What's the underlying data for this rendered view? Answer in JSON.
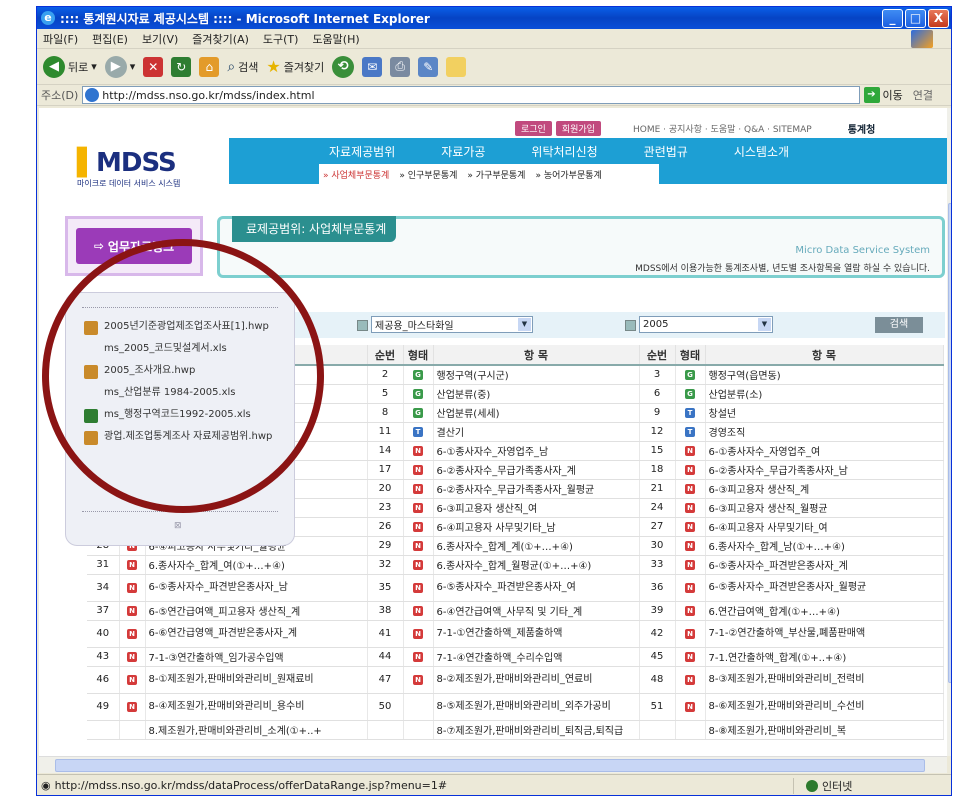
{
  "window": {
    "title": ":::: 통계원시자료 제공시스템 :::: - Microsoft Internet Explorer",
    "min": "_",
    "max": "□",
    "close": "X"
  },
  "menu": {
    "items": [
      "파일(F)",
      "편집(E)",
      "보기(V)",
      "즐겨찾기(A)",
      "도구(T)",
      "도움말(H)"
    ]
  },
  "toolbar": {
    "back": "뒤로",
    "search": "검색",
    "favorites": "즐겨찾기"
  },
  "address": {
    "label": "주소(D)",
    "url": "http://mdss.nso.go.kr/mdss/index.html",
    "go": "이동",
    "links": "연결"
  },
  "site": {
    "top_buttons": [
      "로그인",
      "회원가입"
    ],
    "top_links": "HOME · 공지사항 · 도움말 · Q&A · SITEMAP",
    "agency": "통계청",
    "logo_main": "MDSS",
    "logo_sub": "마이크로 데이터 서비스 시스템",
    "nav": [
      "자료제공범위",
      "자료가공",
      "위탁처리신청",
      "관련법규",
      "시스템소개"
    ],
    "subnav": [
      "» 사업체부문통계",
      "» 인구부문통계",
      "» 가구부문통계",
      "» 농어가부문통계"
    ],
    "side_button": "업무자료링크",
    "banner_tab": "료제공범위: 사업체부문통계",
    "banner_brand": "Micro Data Service System",
    "banner_desc": "MDSS에서 이용가능한 통계조사별, 년도별 조사항목을 열람 하실 수 있습니다."
  },
  "popup": {
    "files": [
      {
        "name": "2005년기준광업제조업조사표[1].hwp",
        "icon": "hwp-icon"
      },
      {
        "name": "ms_2005_코드및설계서.xls",
        "icon": ""
      },
      {
        "name": "2005_조사개요.hwp",
        "icon": "hwp-icon"
      },
      {
        "name": "ms_산업분류 1984-2005.xls",
        "icon": ""
      },
      {
        "name": "ms_행정구역코드1992-2005.xls",
        "icon": "excel-icon"
      },
      {
        "name": "광업.제조업통계조사 자료제공범위.hwp",
        "icon": "hwp-icon"
      }
    ],
    "close": "⊠"
  },
  "filter": {
    "file": "제공용_마스타화일",
    "year": "2005",
    "search": "검색"
  },
  "table": {
    "headers": [
      "",
      "",
      "",
      "순번",
      "형태",
      "항 목",
      "순번",
      "형태",
      "항 목"
    ],
    "rows": [
      {
        "l": [
          "",
          "",
          ""
        ],
        "m": [
          "2",
          "G",
          "행정구역(구시군)"
        ],
        "r": [
          "3",
          "G",
          "행정구역(읍면동)"
        ]
      },
      {
        "l": [
          "",
          "",
          ""
        ],
        "m": [
          "5",
          "G",
          "산업분류(중)"
        ],
        "r": [
          "6",
          "G",
          "산업분류(소)"
        ]
      },
      {
        "l": [
          "",
          "",
          ""
        ],
        "m": [
          "8",
          "G",
          "산업분류(세세)"
        ],
        "r": [
          "9",
          "T",
          "창설년"
        ]
      },
      {
        "l": [
          "",
          "",
          ""
        ],
        "m": [
          "11",
          "T",
          "결산기"
        ],
        "r": [
          "12",
          "T",
          "경영조직"
        ]
      },
      {
        "l": [
          "",
          "",
          ""
        ],
        "m": [
          "14",
          "N",
          "6-①종사자수_자영업주_남"
        ],
        "r": [
          "15",
          "N",
          "6-①종사자수_자영업주_여"
        ]
      },
      {
        "l": [
          "",
          "",
          "월평균"
        ],
        "m": [
          "17",
          "N",
          "6-②종사자수_무급가족종사자_계"
        ],
        "r": [
          "18",
          "N",
          "6-②종사자수_무급가족종사자_남"
        ]
      },
      {
        "l": [
          "",
          "",
          "사자_여"
        ],
        "m": [
          "20",
          "N",
          "6-②종사자수_무급가족종사자_월평균"
        ],
        "r": [
          "21",
          "N",
          "6-③피고용자 생산직_계"
        ]
      },
      {
        "l": [
          "",
          "",
          ""
        ],
        "m": [
          "23",
          "N",
          "6-③피고용자 생산직_여"
        ],
        "r": [
          "24",
          "N",
          "6-③피고용자 생산직_월평균"
        ]
      },
      {
        "l": [
          "",
          "",
          "_계"
        ],
        "m": [
          "26",
          "N",
          "6-④피고용자 사무및기타_남"
        ],
        "r": [
          "27",
          "N",
          "6-④피고용자 사무및기타_여"
        ]
      },
      {
        "l": [
          "28",
          "N",
          "6-④피고용자 사무및기타_월평균"
        ],
        "m": [
          "29",
          "N",
          "6.종사자수_합계_계(①+…+④)"
        ],
        "r": [
          "30",
          "N",
          "6.종사자수_합계_남(①+…+④)"
        ]
      },
      {
        "l": [
          "31",
          "N",
          "6.종사자수_합계_여(①+…+④)"
        ],
        "m": [
          "32",
          "N",
          "6.종사자수_합계_월평균(①+…+④)"
        ],
        "r": [
          "33",
          "N",
          "6-⑤종사자수_파견받은종사자_계"
        ]
      },
      {
        "l": [
          "34",
          "N",
          "6-⑤종사자수_파견받은종사자_남"
        ],
        "m": [
          "35",
          "N",
          "6-⑤종사자수_파견받은종사자_여"
        ],
        "r": [
          "36",
          "N",
          "6-⑤종사자수_파견받은종사자_월평균"
        ],
        "tall": true
      },
      {
        "l": [
          "37",
          "N",
          "6-⑤연간급여액_피고용자 생산직_계"
        ],
        "m": [
          "38",
          "N",
          "6-④연간급여액_사무직 및 기타_계"
        ],
        "r": [
          "39",
          "N",
          "6.연간급여액_합계(①+…+④)"
        ]
      },
      {
        "l": [
          "40",
          "N",
          "6-⑥연간급영액_파견받은종사자_계"
        ],
        "m": [
          "41",
          "N",
          "7-1-①연간출하액_제품출하액"
        ],
        "r": [
          "42",
          "N",
          "7-1-②연간출하액_부산물,폐품판매액"
        ],
        "tall": true
      },
      {
        "l": [
          "43",
          "N",
          "7-1-③연간출하액_임가공수입액"
        ],
        "m": [
          "44",
          "N",
          "7-1-④연간출하액_수리수입액"
        ],
        "r": [
          "45",
          "N",
          "7-1.연간출하액_합계(①+..+④)"
        ]
      },
      {
        "l": [
          "46",
          "N",
          "8-①제조원가,판매비와관리비_원재료비"
        ],
        "m": [
          "47",
          "N",
          "8-②제조원가,판매비와관리비_연료비"
        ],
        "r": [
          "48",
          "N",
          "8-③제조원가,판매비와관리비_전력비"
        ],
        "tall": true
      },
      {
        "l": [
          "49",
          "N",
          "8-④제조원가,판매비와관리비_용수비"
        ],
        "m": [
          "50",
          "",
          "8-⑤제조원가,판매비와관리비_외주가공비"
        ],
        "r": [
          "51",
          "N",
          "8-⑥제조원가,판매비와관리비_수선비"
        ],
        "tall": true
      },
      {
        "l": [
          "",
          "",
          "8.제조원가,판매비와관리비_소계(①+..+"
        ],
        "m": [
          "",
          "",
          "8-⑦제조원가,판매비와관리비_퇴직금,퇴직급"
        ],
        "r": [
          "",
          "",
          "8-⑧제조원가,판매비와관리비_복"
        ]
      }
    ]
  },
  "status": {
    "url": "http://mdss.nso.go.kr/mdss/dataProcess/offerDataRange.jsp?menu=1#",
    "zone": "인터넷"
  }
}
